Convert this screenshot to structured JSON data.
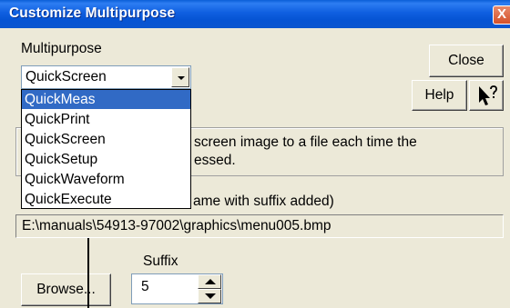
{
  "window": {
    "title": "Customize Multipurpose",
    "close_glyph": "X"
  },
  "multipurpose": {
    "label": "Multipurpose",
    "selected_value": "QuickScreen",
    "options": [
      "QuickMeas",
      "QuickPrint",
      "QuickScreen",
      "QuickSetup",
      "QuickWaveform",
      "QuickExecute"
    ],
    "highlighted_index": 0
  },
  "buttons": {
    "close": "Close",
    "help": "Help",
    "whats_this_icon": "arrow-question-icon",
    "browse": "Browse..."
  },
  "description": {
    "line1": "screen image to a file each time the",
    "line2": "essed."
  },
  "file": {
    "label_visible": "ame with suffix added)",
    "path": "E:\\manuals\\54913-97002\\graphics\\menu005.bmp"
  },
  "suffix": {
    "label": "Suffix",
    "value": "5"
  },
  "colors": {
    "titlebar": "#0a5fd8",
    "dialog_bg": "#ece9d8",
    "selection": "#316ac5"
  }
}
